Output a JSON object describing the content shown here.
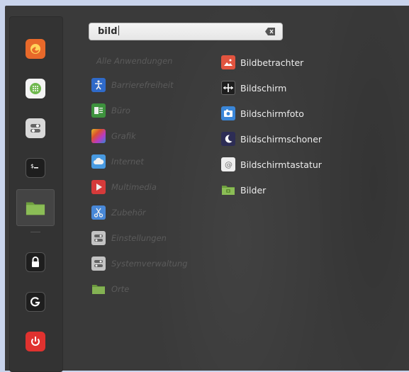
{
  "search": {
    "query": "bild"
  },
  "categories": {
    "all_label": "Alle Anwendungen",
    "items": [
      {
        "label": "Barrierefreiheit",
        "icon": "accessibility-icon",
        "color": "#2f6fd6"
      },
      {
        "label": "Büro",
        "icon": "office-icon",
        "color": "#3e9a3e"
      },
      {
        "label": "Grafik",
        "icon": "graphics-icon",
        "color": "#c43ad0"
      },
      {
        "label": "Internet",
        "icon": "cloud-icon",
        "color": "#4aa3f0"
      },
      {
        "label": "Multimedia",
        "icon": "play-icon",
        "color": "#e33b3b"
      },
      {
        "label": "Zubehör",
        "icon": "scissors-icon",
        "color": "#4a8fe6"
      },
      {
        "label": "Einstellungen",
        "icon": "toggle-settings-icon",
        "color": "#9a9a9a"
      },
      {
        "label": "Systemverwaltung",
        "icon": "system-admin-icon",
        "color": "#9a9a9a"
      },
      {
        "label": "Orte",
        "icon": "folder-icon",
        "color": "#7fb24a"
      }
    ]
  },
  "results": [
    {
      "label": "Bildbetrachter",
      "icon": "image-viewer-icon",
      "color": "#e2543f"
    },
    {
      "label": "Bildschirm",
      "icon": "display-icon",
      "color": "#2a2a2a"
    },
    {
      "label": "Bildschirmfoto",
      "icon": "camera-icon",
      "color": "#3a86d8"
    },
    {
      "label": "Bildschirmschoner",
      "icon": "moon-icon",
      "color": "#3a3a6a"
    },
    {
      "label": "Bildschirmtastatur",
      "icon": "at-keyboard-icon",
      "color": "#eeeeee"
    },
    {
      "label": "Bilder",
      "icon": "pictures-folder-icon",
      "color": "#7fb24a"
    }
  ],
  "favorites": [
    {
      "name": "firefox-icon",
      "color": "#e8692a"
    },
    {
      "name": "software-manager-icon",
      "color": "#6fb84e"
    },
    {
      "name": "settings-toggle-icon",
      "color": "#d9d9d9"
    },
    {
      "name": "terminal-icon",
      "color": "#1e1e1e"
    },
    {
      "name": "files-folder-icon",
      "color": "#7fb24a"
    },
    {
      "name": "lock-icon",
      "color": "#1e1e1e"
    },
    {
      "name": "logout-icon",
      "color": "#1e1e1e"
    },
    {
      "name": "power-icon",
      "color": "#e0322f"
    }
  ]
}
